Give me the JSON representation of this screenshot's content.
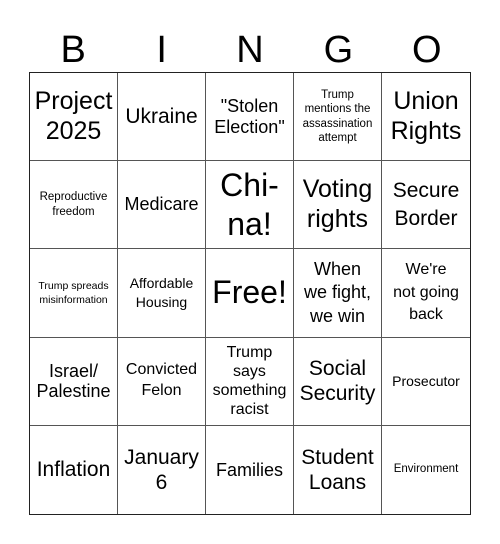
{
  "title_letters": [
    "B",
    "I",
    "N",
    "G",
    "O"
  ],
  "cells": [
    {
      "text": "Project\n2025"
    },
    {
      "text": "Ukraine"
    },
    {
      "text": "\"Stolen\nElection\""
    },
    {
      "text": "Trump\nmentions the\nassassination\nattempt"
    },
    {
      "text": "Union\nRights"
    },
    {
      "text": "Reproductive\nfreedom"
    },
    {
      "text": "Medicare"
    },
    {
      "text": "Chi-\nna!"
    },
    {
      "text": "Voting\nrights"
    },
    {
      "text": "Secure\nBorder"
    },
    {
      "text": "Trump spreads\nmisinformation"
    },
    {
      "text": "Affordable\nHousing"
    },
    {
      "text": "Free!",
      "free_space": true
    },
    {
      "text": "When\nwe fight,\nwe win"
    },
    {
      "text": "We're\nnot going\nback"
    },
    {
      "text": "Israel/\nPalestine"
    },
    {
      "text": "Convicted\nFelon"
    },
    {
      "text": "Trump\nsays\nsomething\nracist"
    },
    {
      "text": "Social\nSecurity"
    },
    {
      "text": "Prosecutor"
    },
    {
      "text": "Inflation"
    },
    {
      "text": "January\n6"
    },
    {
      "text": "Families"
    },
    {
      "text": "Student\nLoans"
    },
    {
      "text": "Environment"
    }
  ]
}
